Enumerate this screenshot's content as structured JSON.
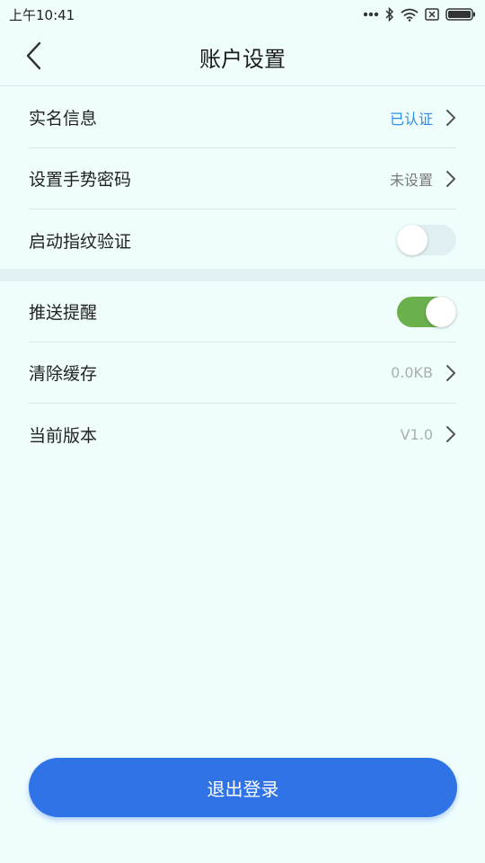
{
  "status_bar": {
    "time": "上午10:41",
    "icons": [
      "more-dots-icon",
      "bluetooth-icon",
      "wifi-icon",
      "sim-x-icon",
      "battery-icon"
    ]
  },
  "header": {
    "title": "账户设置",
    "back_icon": "chevron-left-icon"
  },
  "settings_group_1": [
    {
      "label": "实名信息",
      "value": "已认证",
      "value_color": "#2b8fe6",
      "type": "link"
    },
    {
      "label": "设置手势密码",
      "value": "未设置",
      "value_color": "#7a7a7a",
      "type": "link"
    },
    {
      "label": "启动指纹验证",
      "type": "toggle",
      "enabled": false
    }
  ],
  "settings_group_2": [
    {
      "label": "推送提醒",
      "type": "toggle",
      "enabled": true
    },
    {
      "label": "清除缓存",
      "value": "0.0KB",
      "value_color": "#a8b0b0",
      "type": "link"
    },
    {
      "label": "当前版本",
      "value": "V1.0",
      "value_color": "#a8b0b0",
      "type": "link"
    }
  ],
  "logout": {
    "label": "退出登录",
    "color": "#2f73e6"
  },
  "colors": {
    "background": "#effdfd",
    "toggle_on": "#6ab04c",
    "accent_blue": "#2b8fe6"
  }
}
